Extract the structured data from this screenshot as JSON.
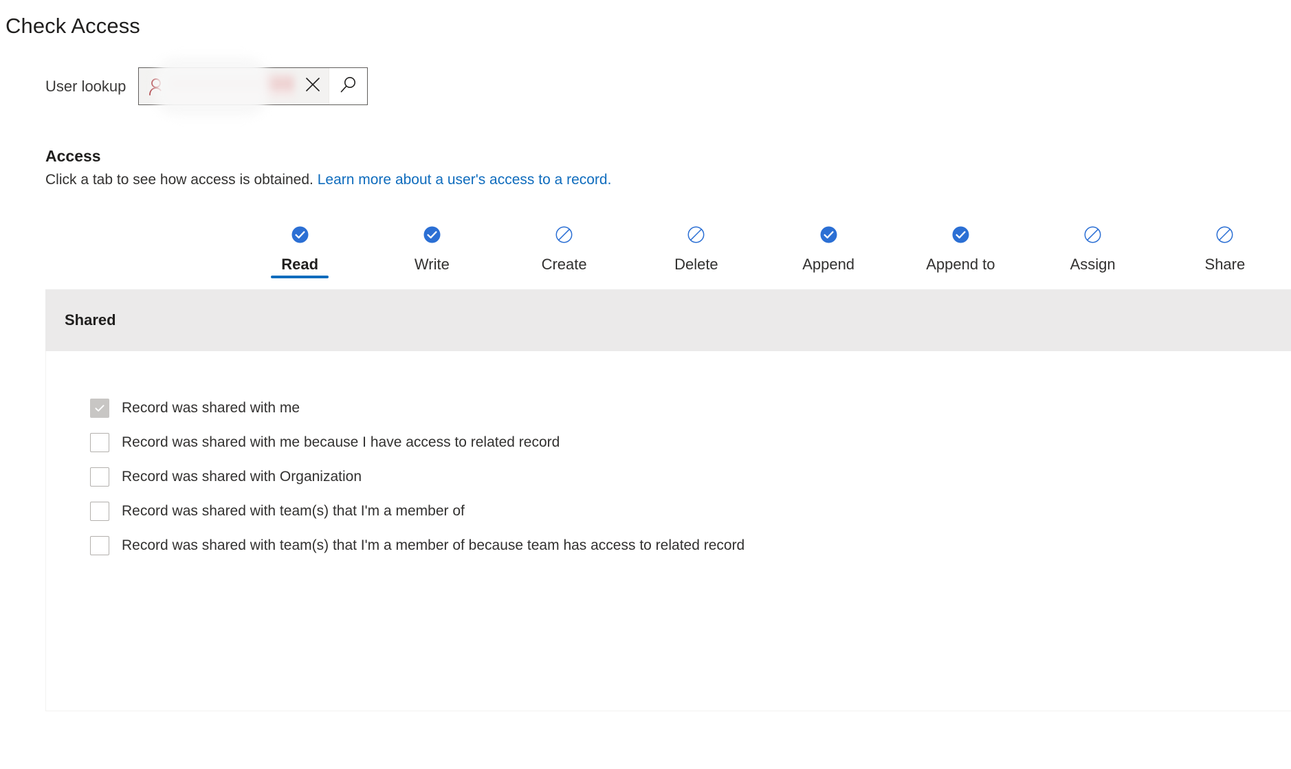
{
  "page": {
    "title": "Check Access"
  },
  "lookup": {
    "label": "User lookup",
    "value": "",
    "person_icon": "person-icon",
    "clear_icon": "close-icon",
    "search_icon": "search-icon",
    "redacted": true
  },
  "access": {
    "heading": "Access",
    "description": "Click a tab to see how access is obtained.",
    "link_text": "Learn more about a user's access to a record.",
    "link_color": "#0f6cbd"
  },
  "tabs": [
    {
      "label": "Read",
      "state": "granted",
      "icon": "check-circle-icon",
      "active": true
    },
    {
      "label": "Write",
      "state": "granted",
      "icon": "check-circle-icon",
      "active": false
    },
    {
      "label": "Create",
      "state": "denied",
      "icon": "prohibition-circle-icon",
      "active": false
    },
    {
      "label": "Delete",
      "state": "denied",
      "icon": "prohibition-circle-icon",
      "active": false
    },
    {
      "label": "Append",
      "state": "granted",
      "icon": "check-circle-icon",
      "active": false
    },
    {
      "label": "Append to",
      "state": "granted",
      "icon": "check-circle-icon",
      "active": false
    },
    {
      "label": "Assign",
      "state": "denied",
      "icon": "prohibition-circle-icon",
      "active": false
    },
    {
      "label": "Share",
      "state": "denied",
      "icon": "prohibition-circle-icon",
      "active": false
    }
  ],
  "panel": {
    "header": "Shared",
    "rows": [
      {
        "label": "Record was shared with me",
        "checked": true,
        "disabled": true
      },
      {
        "label": "Record was shared with me because I have access to related record",
        "checked": false,
        "disabled": false
      },
      {
        "label": "Record was shared with Organization",
        "checked": false,
        "disabled": false
      },
      {
        "label": "Record was shared with team(s) that I'm a member of",
        "checked": false,
        "disabled": false
      },
      {
        "label": "Record was shared with team(s) that I'm a member of because team has access to related record",
        "checked": false,
        "disabled": false
      }
    ]
  },
  "colors": {
    "accent_blue": "#2b6fd4",
    "link_blue": "#0f6cbd",
    "header_gray": "#ebeaea",
    "person_icon_red": "#a4262c",
    "disabled_checkbox": "#c8c6c4"
  }
}
